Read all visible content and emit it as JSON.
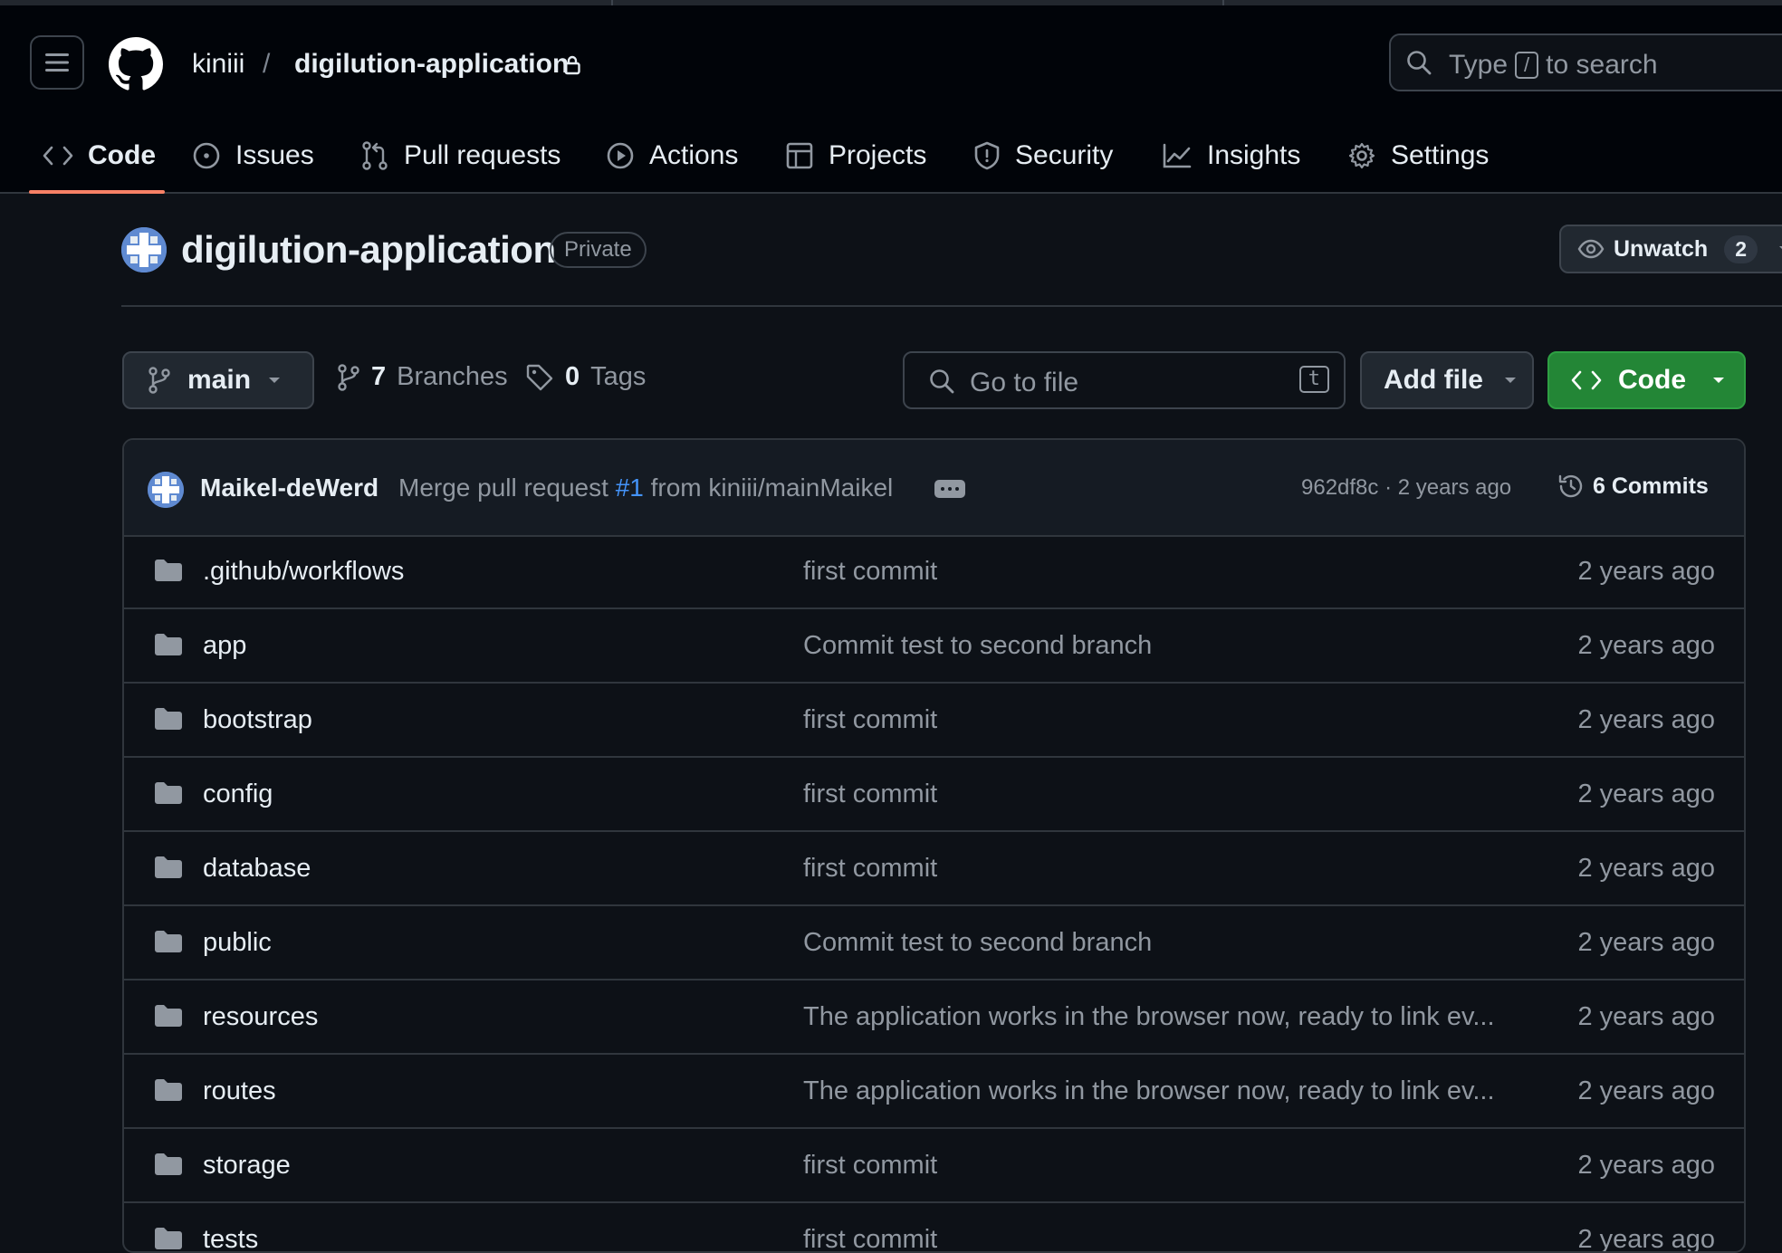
{
  "header": {
    "owner": "kiniii",
    "separator": "/",
    "repo": "digilution-application",
    "search_prefix": "Type",
    "search_key": "/",
    "search_suffix": "to search"
  },
  "nav": {
    "tabs": [
      {
        "label": "Code",
        "icon": "code-icon",
        "active": true
      },
      {
        "label": "Issues",
        "icon": "issue-icon"
      },
      {
        "label": "Pull requests",
        "icon": "pull-request-icon"
      },
      {
        "label": "Actions",
        "icon": "play-icon"
      },
      {
        "label": "Projects",
        "icon": "table-icon"
      },
      {
        "label": "Security",
        "icon": "shield-icon"
      },
      {
        "label": "Insights",
        "icon": "graph-icon"
      },
      {
        "label": "Settings",
        "icon": "gear-icon"
      }
    ]
  },
  "repo": {
    "title": "digilution-application",
    "visibility": "Private",
    "unwatch_label": "Unwatch",
    "watchers": "2"
  },
  "toolbar": {
    "branch": "main",
    "branches_count": "7",
    "branches_label": "Branches",
    "tags_count": "0",
    "tags_label": "Tags",
    "goto_placeholder": "Go to file",
    "goto_key": "t",
    "add_file": "Add file",
    "code": "Code"
  },
  "latest_commit": {
    "author": "Maikel-deWerd",
    "message_prefix": "Merge pull request",
    "pr": "#1",
    "message_suffix": "from kiniii/mainMaikel",
    "hash_time": "962df8c · 2 years ago",
    "commits": "6 Commits"
  },
  "files": [
    {
      "name": ".github/workflows",
      "message": "first commit",
      "time": "2 years ago"
    },
    {
      "name": "app",
      "message": "Commit test to second branch",
      "time": "2 years ago"
    },
    {
      "name": "bootstrap",
      "message": "first commit",
      "time": "2 years ago"
    },
    {
      "name": "config",
      "message": "first commit",
      "time": "2 years ago"
    },
    {
      "name": "database",
      "message": "first commit",
      "time": "2 years ago"
    },
    {
      "name": "public",
      "message": "Commit test to second branch",
      "time": "2 years ago"
    },
    {
      "name": "resources",
      "message": "The application works in the browser now, ready to link ev...",
      "time": "2 years ago"
    },
    {
      "name": "routes",
      "message": "The application works in the browser now, ready to link ev...",
      "time": "2 years ago"
    },
    {
      "name": "storage",
      "message": "first commit",
      "time": "2 years ago"
    },
    {
      "name": "tests",
      "message": "first commit",
      "time": "2 years ago"
    }
  ],
  "colors": {
    "background": "#0d1117",
    "header": "#010409",
    "accent_underline": "#f78166",
    "code_button": "#238636",
    "link": "#4493f8"
  }
}
